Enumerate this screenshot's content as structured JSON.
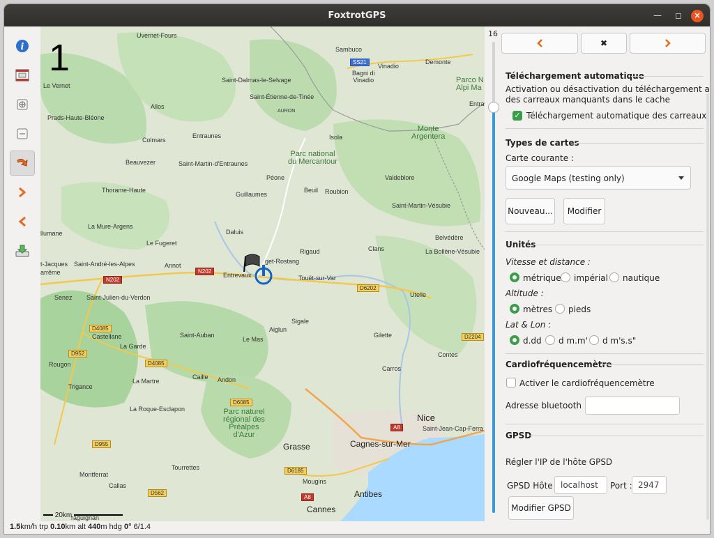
{
  "window": {
    "title": "FoxtrotGPS"
  },
  "toolbar": {
    "items": [
      {
        "name": "info-icon"
      },
      {
        "name": "film-icon"
      },
      {
        "name": "zoom-in-icon"
      },
      {
        "name": "zoom-out-icon"
      },
      {
        "name": "autocenter-icon",
        "active": true
      },
      {
        "name": "next-icon"
      },
      {
        "name": "prev-icon"
      },
      {
        "name": "download-icon"
      }
    ]
  },
  "map": {
    "zoom_overlay": "1",
    "scale_label": "20km",
    "labels": {
      "uvernet": "Uvernet-Fours",
      "sambuco": "Sambuco",
      "levernet": "Le Vernet",
      "dalmas": "Saint-Dalmas-le-Selvage",
      "vinadio": "Vinadio",
      "demonte": "Demonte",
      "bagni": "Bagni di\nVinadio",
      "parcon": "Parco N\nAlpi Ma",
      "etienne": "Saint-Étienne-de-Tinée",
      "allos": "Allos",
      "auron": "AURON",
      "entrac": "Entrac",
      "prads": "Prads-Haute-Bléone",
      "colmars": "Colmars",
      "entraunes": "Entraunes",
      "isola": "Isola",
      "argentera": "Monte\nArgentera",
      "beauvezer": "Beauvezer",
      "martin_entr": "Saint-Martin-d'Entraunes",
      "mercantour": "Parc national\ndu Mercantour",
      "valdeblore": "Valdeblore",
      "thorame": "Thorame-Haute",
      "peone": "Péone",
      "guillaumes": "Guillaumes",
      "beuil": "Beuil",
      "roubion": "Roubion",
      "vesubie": "Saint-Martin-Vésubie",
      "muraargens": "La Mure-Argens",
      "daluis": "Daluis",
      "lumane": "llumane",
      "fugeret": "Le Fugeret",
      "rigaud": "Rigaud",
      "clans": "Clans",
      "belvedere": "Belvédère",
      "bollene": "La Bollène-Vésubie",
      "jacques": "t-Jacques",
      "andre": "Saint-André-les-Alpes",
      "annot": "Annot",
      "rostang": "get-Rostang",
      "barreme": "arrême",
      "entrevaux": "Entrevaux",
      "touet": "Touët-sur-Var",
      "senez": "Senez",
      "julien": "Saint-Julien-du-Verdon",
      "utelle": "Utelle",
      "sigale": "Sigale",
      "aiglun": "Aiglun",
      "castellane": "Castellane",
      "auban": "Saint-Auban",
      "lemas": "Le Mas",
      "gilette": "Gilette",
      "lagarde": "La Garde",
      "rougon": "Rougon",
      "carros": "Carros",
      "contes": "Contes",
      "caille": "Caille",
      "andon": "Andon",
      "trigance": "Trigance",
      "lamartre": "La Martre",
      "esclapon": "La Roque-Esclapon",
      "prealpes": "Parc naturel\nrégional des\nPréalpes\nd'Azur",
      "nice": "Nice",
      "capferrat": "Saint-Jean-Cap-Ferra",
      "grasse": "Grasse",
      "cagnes": "Cagnes-sur-Mer",
      "tourrettes": "Tourrettes",
      "montferrat": "Montferrat",
      "callas": "Callas",
      "mougins": "Mougins",
      "antibes": "Antibes",
      "cannes": "Cannes",
      "draguignan": "raguignan"
    },
    "roads": {
      "ss21": "SS21",
      "n202a": "N202",
      "n202b": "N202",
      "d6202": "D6202",
      "d4085a": "D4085",
      "d952": "D952",
      "d4085b": "D4085",
      "d6085": "D6085",
      "d2204": "D2204",
      "d955": "D955",
      "a8a": "A8",
      "d6185": "D6185",
      "d562": "D562",
      "a8b": "A8"
    }
  },
  "zoom_slider": {
    "value": "16",
    "level_fraction": 0.86
  },
  "panel": {
    "nav": {
      "prev": "‹",
      "close": "✖",
      "next": "›"
    },
    "autodl": {
      "title": "Téléchargement automatique",
      "desc1": "Activation ou désactivation du téléchargement auto",
      "desc2": "des carreaux manquants dans le cache",
      "checkbox_label": "Téléchargement automatique des carreaux",
      "checked": true
    },
    "maptypes": {
      "title": "Types de cartes",
      "current_label": "Carte courante :",
      "selected": "Google Maps (testing only)",
      "new_button": "Nouveau...",
      "edit_button": "Modifier"
    },
    "units": {
      "title": "Unités",
      "speed_label": "Vitesse et distance :",
      "speed_options": [
        "métrique",
        "impérial",
        "nautique"
      ],
      "speed_selected": 0,
      "alt_label": "Altitude :",
      "alt_options": [
        "mètres",
        "pieds"
      ],
      "alt_selected": 0,
      "latlon_label": "Lat & Lon :",
      "latlon_options": [
        "d.dd",
        "d m.m'",
        "d m's.s\""
      ],
      "latlon_selected": 0
    },
    "hr": {
      "title": "Cardiofréquencemètre",
      "checkbox_label": "Activer le cardiofréquencemètre",
      "checked": false,
      "bt_label": "Adresse bluetooth :",
      "bt_value": ""
    },
    "gpsd": {
      "title": "GPSD",
      "desc": "Régler l'IP de l'hôte GPSD",
      "host_label": "GPSD Hôte :",
      "host_value": "localhost",
      "port_label": "Port :",
      "port_value": "2947",
      "button": "Modifier GPSD"
    }
  },
  "status": {
    "speed": "1.5",
    "speed_unit": "km/h",
    "trp_label": "trp",
    "trp": "0.10",
    "trp_unit": "km",
    "alt_label": "alt",
    "alt": "440",
    "alt_unit": "m",
    "hdg_label": "hdg",
    "hdg": "0°",
    "sats": "6/1.4"
  }
}
